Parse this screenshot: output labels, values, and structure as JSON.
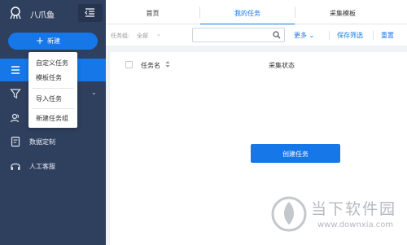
{
  "app": {
    "name": "八爪鱼"
  },
  "sidebar": {
    "new_button": {
      "icon": "plus-icon",
      "label": "新建"
    },
    "items": [
      {
        "icon": "list-icon",
        "label": "",
        "active": true
      },
      {
        "icon": "filter-icon",
        "label": "",
        "has_caret": true
      },
      {
        "icon": "users-icon",
        "label": ""
      },
      {
        "icon": "document-icon",
        "label": "数据定制"
      },
      {
        "icon": "headset-icon",
        "label": "人工客服"
      }
    ]
  },
  "new_menu": {
    "items": [
      "自定义任务",
      "模板任务",
      "导入任务",
      "新建任务组"
    ]
  },
  "tabs": [
    {
      "label": "首页",
      "active": false
    },
    {
      "label": "我的任务",
      "active": true
    },
    {
      "label": "采集模板",
      "active": false
    }
  ],
  "filter_bar": {
    "group_label": "任务组:",
    "group_value": "全部",
    "search_placeholder": "",
    "more_label": "更多",
    "save_filter_label": "保存筛选",
    "reset_label": "重置"
  },
  "table": {
    "columns": [
      "任务名",
      "采集状态"
    ]
  },
  "empty_state": {
    "create_button_label": "创建任务"
  },
  "watermark": {
    "text": "当下软件园",
    "url": "www.downxia.com"
  },
  "colors": {
    "sidebar_bg": "#2f3f5e",
    "accent": "#1677e9"
  }
}
